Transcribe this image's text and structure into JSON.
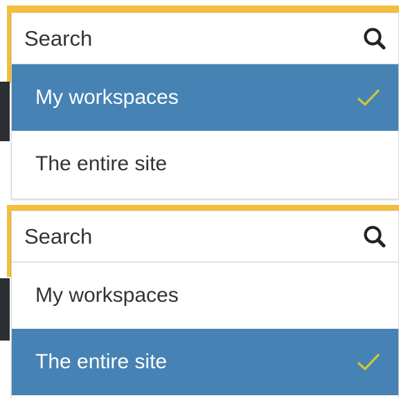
{
  "panels": [
    {
      "search": {
        "placeholder": "Search",
        "value": ""
      },
      "options": [
        {
          "label": "My workspaces",
          "selected": true
        },
        {
          "label": "The entire site",
          "selected": false
        }
      ]
    },
    {
      "search": {
        "placeholder": "Search",
        "value": ""
      },
      "options": [
        {
          "label": "My workspaces",
          "selected": false
        },
        {
          "label": "The entire site",
          "selected": true
        }
      ]
    }
  ],
  "icons": {
    "search": "search-icon",
    "check": "checkmark-icon"
  },
  "colors": {
    "selected_bg": "#4682b4",
    "check": "#c7c93a",
    "focus_frame": "#f4bf3a"
  }
}
